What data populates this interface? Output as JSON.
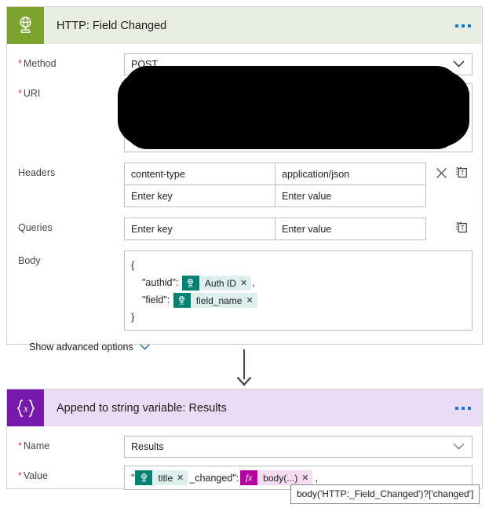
{
  "cards": [
    {
      "icon_name": "globe-network-icon",
      "icon_bg": "#7CA22E",
      "header_bg": "#EAEEE0",
      "title": "HTTP: Field Changed",
      "menu_label": "More commands",
      "fields": {
        "method_label": "Method",
        "method_value": "POST",
        "uri_label": "URI",
        "uri_value": "",
        "headers_label": "Headers",
        "headers_rows": [
          {
            "key": "content-type",
            "value": "application/json"
          },
          {
            "key": "Enter key",
            "value": "Enter value",
            "placeholder": true
          }
        ],
        "queries_label": "Queries",
        "queries_rows": [
          {
            "key": "Enter key",
            "value": "Enter value",
            "placeholder": true
          }
        ],
        "body_label": "Body",
        "body_lines": {
          "open_brace": "{",
          "line1_key": "\"authid\":",
          "line1_token": "Auth ID",
          "line1_suffix": ",",
          "line2_key": "\"field\":",
          "line2_token": "field_name",
          "close_brace": "}"
        },
        "advanced_label": "Show advanced options"
      }
    },
    {
      "icon_name": "variable-braces-x-icon",
      "icon_bg": "#7719AA",
      "header_bg": "#EADCF5",
      "title": "Append to string variable: Results",
      "menu_label": "More commands",
      "fields": {
        "name_label": "Name",
        "name_value": "Results",
        "value_label": "Value",
        "value_parts": {
          "quote_open": "\"",
          "token1": "title",
          "mid_text": "_changed\":",
          "token2": "body(...)",
          "trailing": ","
        }
      }
    }
  ],
  "connector": {
    "name": "flow-arrow-down"
  },
  "tooltip": {
    "text": "body('HTTP:_Field_Changed')?['changed']"
  },
  "icons": {
    "close": "✕",
    "chevron_down": "∨",
    "token_x": "✕",
    "switch_text_mode": "T",
    "fx": "fx"
  },
  "colors": {
    "accent_blue": "#0078d4",
    "required_red": "#d93f3f",
    "token_teal": "#008272",
    "token_teal_bg": "#ddf0ee",
    "token_magenta": "#b4009e",
    "token_magenta_bg": "#f6dcf2"
  }
}
